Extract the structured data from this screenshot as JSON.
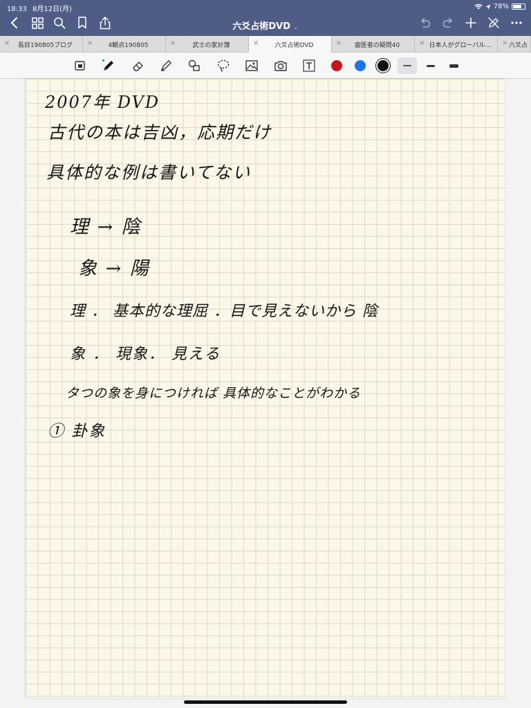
{
  "status": {
    "time": "18:33",
    "date": "8月12日(月)",
    "battery": "78%"
  },
  "header": {
    "title": "六爻占術DVD"
  },
  "tabs": [
    {
      "label": "長目190805ブログ",
      "active": false
    },
    {
      "label": "4観点190805",
      "active": false
    },
    {
      "label": "武士の家計簿",
      "active": false
    },
    {
      "label": "六爻占術DVD",
      "active": true
    },
    {
      "label": "歯医者の疑問40",
      "active": false
    },
    {
      "label": "日本人がグローバル…",
      "active": false
    },
    {
      "label": "六爻占",
      "active": false
    }
  ],
  "toolbar": {
    "colors": [
      "#c8161d",
      "#1b74e8",
      "#111111"
    ],
    "selected_color": "#111111",
    "accent": "#1b74e8"
  },
  "notes": {
    "lines": [
      "2007年 DVD",
      "古代の本は吉凶，応期だけ",
      "具体的な例は書いてない",
      "理 → 陰",
      "象 → 陽",
      "理 ． 基本的な理屈 ．目で見えないから 陰",
      "象 ． 現象． 見える",
      "タつの象を身につければ 具体的なことがわかる",
      "① 卦象"
    ]
  }
}
